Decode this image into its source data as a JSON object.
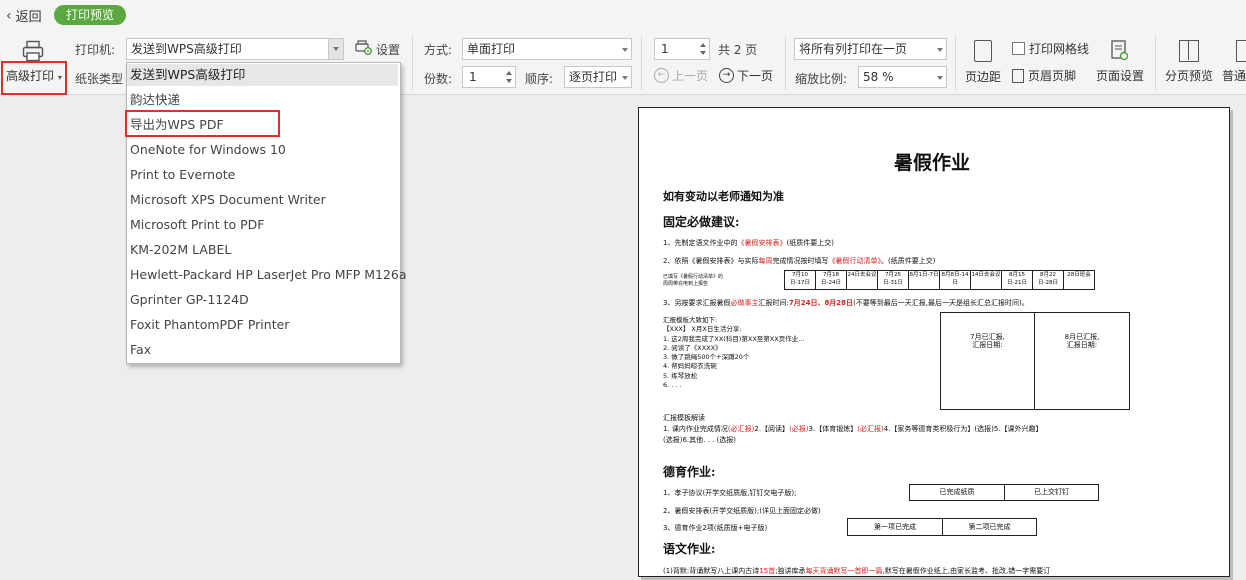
{
  "topbar": {
    "back_label": "返回",
    "mode_badge": "打印预览"
  },
  "toolbar": {
    "advanced_print": "高级打印",
    "printer_label": "打印机:",
    "printer_value": "发送到WPS高级打印",
    "settings_label": "设置",
    "paper_type_label": "纸张类型",
    "method_label": "方式:",
    "method_value": "单面打印",
    "copies_label": "份数:",
    "copies_value": "1",
    "order_label": "顺序:",
    "order_value": "逐页打印",
    "page_value": "1",
    "total_pages": "共 2 页",
    "prev_page": "上一页",
    "next_page": "下一页",
    "fit_value": "将所有列打印在一页",
    "zoom_label": "缩放比例:",
    "zoom_value": "58 %",
    "margins": "页边距",
    "gridlines": "打印网格线",
    "header_footer": "页眉页脚",
    "page_setup": "页面设置",
    "page_break_preview": "分页预览",
    "normal_view": "普通"
  },
  "printer_dropdown": {
    "items": [
      "发送到WPS高级打印",
      "韵达快递",
      "导出为WPS PDF",
      "OneNote for Windows 10",
      "Print to Evernote",
      "Microsoft XPS Document Writer",
      "Microsoft Print to PDF",
      "KM-202M LABEL",
      "Hewlett-Packard HP LaserJet Pro MFP M126a",
      "Gprinter GP-1124D",
      "Foxit PhantomPDF Printer",
      "Fax"
    ]
  },
  "document": {
    "title": "暑假作业",
    "notice": "如有变动以老师通知为准",
    "section1": "固定必做建议:",
    "line1_a": "1、先制定语文作业中的",
    "line1_red": "《暑假安排表》",
    "line1_b": "(纸质件要上交)",
    "line2_a": "2、依照《暑假安排表》与实际",
    "line2_red1": "每周",
    "line2_b": "完成情况按时填写",
    "line2_red2": "《暑假行动清单》",
    "line2_c": "。(纸质件要上交)",
    "table1_left": [
      "已填写《暑假行动清单》的",
      "周周带充电到上报告"
    ],
    "table1_cells": [
      "7月10日-17日",
      "7月18日-24日",
      "24日去会议",
      "7月25日-31日",
      "8月1日-7日",
      "8月8日-14日",
      "14日去会议",
      "8月15日-21日",
      "8月22日-28日",
      "28日班会"
    ],
    "line3_a": "3、另按要求汇报暑假",
    "line3_red": "必做事主",
    "line3_b": "汇报时间:",
    "line3_red2": "7月24日、8月28日",
    "line3_c": "(不要等到最后一天汇报,最后一天是组长汇总汇报时间)。",
    "report_lines": [
      "汇报模板大致如下:",
      "【XXX】 X月X日生活分享:",
      "1. 这2周我完成了XX(科目)第XX至第XX页作业...",
      "2. 阅读了《XXXX》",
      "3. 做了跳绳500个+深蹲20个",
      "4. 帮妈妈晾衣洗碗",
      "5. 练琴放松",
      "6. . . ."
    ],
    "report_box1": [
      "7月已汇报,",
      "汇报日期:"
    ],
    "report_box2": [
      "8月已汇报,",
      "汇报日期:"
    ],
    "explain_title": "汇报模板解读",
    "explain_line1_a": "1. 课内作业完成情况",
    "explain_line1_r1": "(必汇报)",
    "explain_line1_b": "2.【阅读】",
    "explain_line1_r2": "(必报)",
    "explain_line1_c": "3.【体育锻炼】",
    "explain_line1_r3": "(必汇报)",
    "explain_line1_d": "4.【家务等德育类积极行为】(选报)5.【课外兴趣】",
    "explain_line2": "(选报)6.其他. . . (选报)",
    "section2": "德育作业:",
    "moral1": "1、孝子协议(开学交纸质版,钉钉交电子版);",
    "moral1_box1": "已完成纸质",
    "moral1_box2": "已上交钉钉",
    "moral2": "2、暑假安排表(开学交纸质版);(详见上面固定必做)",
    "moral3": "3、德育作业2项(纸质版+电子版)",
    "moral3_box1": "第一项已完成",
    "moral3_box2": "第二项已完成",
    "section3": "语文作业:",
    "chinese1_a": "(1)背默:背诵默写八上课内古诗",
    "chinese1_r1": "15首",
    "chinese1_b": ";独讲库承",
    "chinese1_r2": "每天背诵默写一首即一篇",
    "chinese1_c": ",默写在暑假作业纸上,由家长监考、批改,错一字需要订"
  }
}
